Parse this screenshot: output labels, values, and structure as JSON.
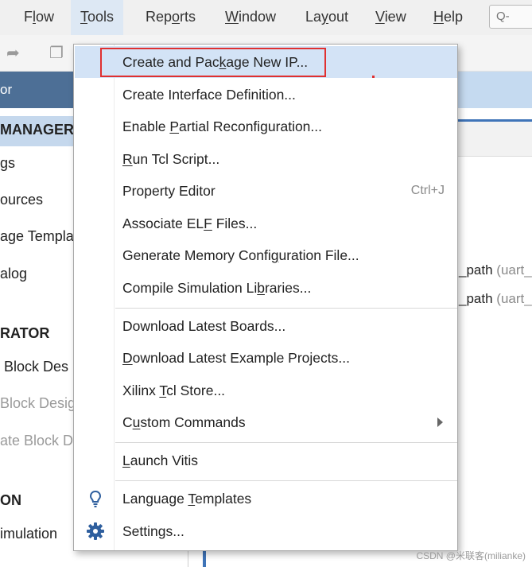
{
  "menubar": {
    "items": [
      {
        "label": "Flow"
      },
      {
        "label": "Tools"
      },
      {
        "label": "Reports"
      },
      {
        "label": "Window"
      },
      {
        "label": "Layout"
      },
      {
        "label": "View"
      },
      {
        "label": "Help"
      }
    ],
    "search_text": "Q-"
  },
  "flow_navigator": {
    "header": "or",
    "rows": [
      {
        "text": "MANAGER",
        "kind": "section"
      },
      {
        "text": "gs",
        "kind": "item"
      },
      {
        "text": "ources",
        "kind": "item"
      },
      {
        "text": "age Templa",
        "kind": "item"
      },
      {
        "text": "alog",
        "kind": "item"
      },
      {
        "text": "RATOR",
        "kind": "section"
      },
      {
        "text": "Block Des",
        "kind": "item"
      },
      {
        "text": "Block Desig",
        "kind": "disabled"
      },
      {
        "text": "ate Block D",
        "kind": "disabled"
      },
      {
        "text": "ON",
        "kind": "section"
      },
      {
        "text": "imulation",
        "kind": "item"
      }
    ]
  },
  "editor": {
    "lines": [
      {
        "code": "_path",
        "hint": "(uart_"
      },
      {
        "code": "_path",
        "hint": "(uart_"
      }
    ]
  },
  "tools_menu": {
    "groups": [
      [
        {
          "label": "Create and Package New IP...",
          "highlighted": true
        },
        {
          "label": "Create Interface Definition..."
        },
        {
          "label": "Enable Partial Reconfiguration..."
        },
        {
          "label": "Run Tcl Script..."
        },
        {
          "label": "Property Editor",
          "accelerator": "Ctrl+J"
        },
        {
          "label": "Associate ELF Files..."
        },
        {
          "label": "Generate Memory Configuration File..."
        },
        {
          "label": "Compile Simulation Libraries..."
        }
      ],
      [
        {
          "label": "Download Latest Boards..."
        },
        {
          "label": "Download Latest Example Projects..."
        },
        {
          "label": "Xilinx Tcl Store..."
        },
        {
          "label": "Custom Commands",
          "submenu": true
        }
      ],
      [
        {
          "label": "Launch Vitis"
        }
      ],
      [
        {
          "label": "Language Templates",
          "icon": "lightbulb-icon"
        },
        {
          "label": "Settings...",
          "icon": "gear-icon"
        }
      ]
    ]
  },
  "watermark": "CSDN @米联客(milianke)",
  "colors": {
    "menu_highlight": "#d3e3f6",
    "annotation_red": "#e03030",
    "navigator_header": "#4d6f96",
    "icon_blue": "#2f5f9e"
  }
}
